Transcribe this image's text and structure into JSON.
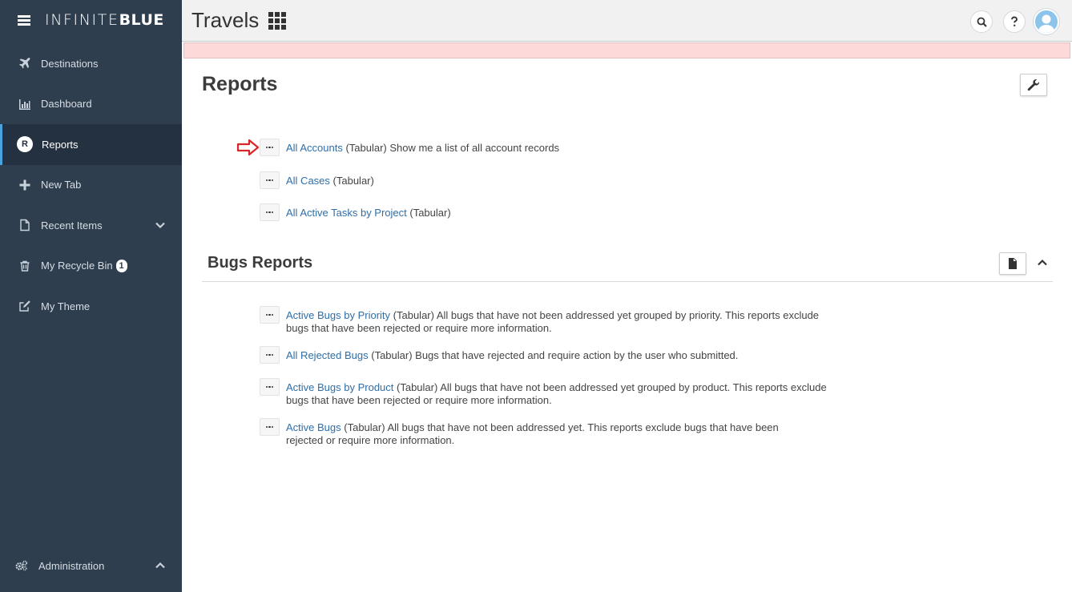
{
  "brand": {
    "logo_light": "INFINITE",
    "logo_bold": "BLUE"
  },
  "sidebar": {
    "items": [
      {
        "label": "Destinations",
        "icon": "plane-icon"
      },
      {
        "label": "Dashboard",
        "icon": "bar-chart-icon"
      },
      {
        "label": "Reports",
        "icon": "r-circle-icon",
        "badge_letter": "R",
        "active": true
      },
      {
        "label": "New Tab",
        "icon": "plus-icon"
      },
      {
        "label": "Recent Items",
        "icon": "document-icon"
      },
      {
        "label": "My Recycle Bin",
        "icon": "trash-icon",
        "count": "1"
      },
      {
        "label": "My Theme",
        "icon": "edit-icon"
      }
    ],
    "admin_label": "Administration"
  },
  "topbar": {
    "app_title": "Travels"
  },
  "colors": {
    "sidebar_bg": "#2f3e4e",
    "sidebar_active": "#233140",
    "link": "#2f6ea8",
    "alert_bg": "#fdd9d9",
    "arrow_red": "#d9262b"
  },
  "page": {
    "title": "Reports"
  },
  "reports": [
    {
      "link": "All Accounts",
      "desc": " (Tabular) Show me a list of all account records",
      "highlighted": true
    },
    {
      "link": "All Cases",
      "desc": " (Tabular)"
    },
    {
      "link": "All Active Tasks by Project",
      "desc": " (Tabular)"
    }
  ],
  "bugs_section": {
    "title": "Bugs Reports",
    "reports": [
      {
        "link": "Active Bugs by Priority",
        "desc": " (Tabular) All bugs that have not been addressed yet grouped by priority. This reports exclude bugs that have been rejected or require more information."
      },
      {
        "link": "All Rejected Bugs",
        "desc": " (Tabular) Bugs that have rejected and require action by the user who submitted."
      },
      {
        "link": "Active Bugs by Product",
        "desc": " (Tabular) All bugs that have not been addressed yet grouped by product. This reports exclude bugs that have been rejected or require more information."
      },
      {
        "link": "Active Bugs",
        "desc": " (Tabular) All bugs that have not been addressed yet. This reports exclude bugs that have been rejected or require more information."
      }
    ]
  }
}
